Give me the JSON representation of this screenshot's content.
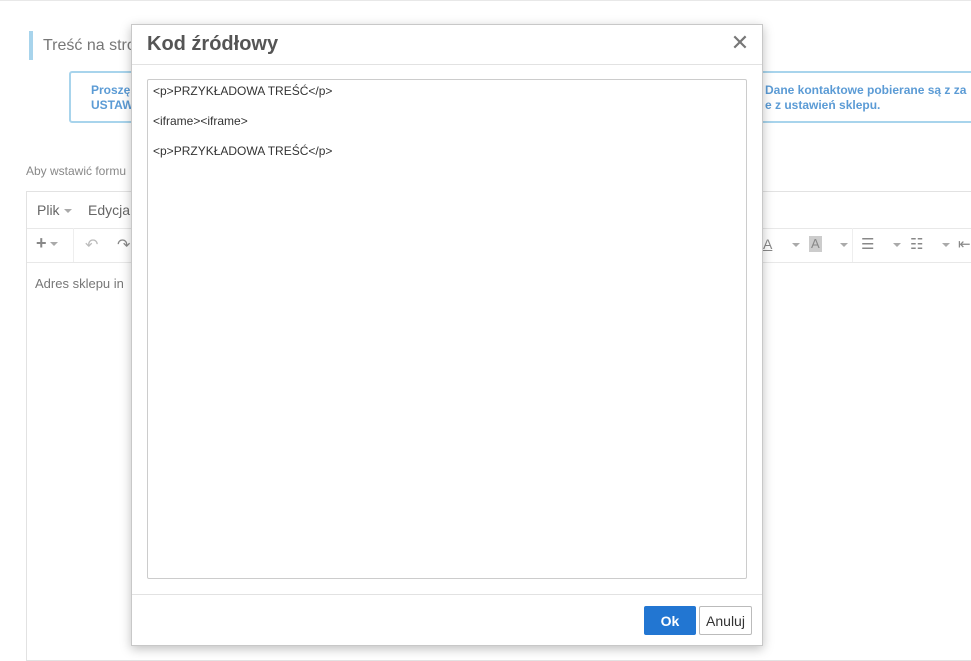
{
  "page": {
    "section_title": "Treść na stro",
    "info_left_line1": "Proszę",
    "info_left_line2": "USTAW",
    "info_right_line1": "Dane kontaktowe pobierane są z za",
    "info_right_line2": "e z ustawień sklepu.",
    "hint": "Aby wstawić formu"
  },
  "editor": {
    "menu": [
      {
        "label": "Plik"
      },
      {
        "label": "Edycja"
      }
    ],
    "content_text": "Adres sklepu in"
  },
  "modal": {
    "title": "Kod źródłowy",
    "close_symbol": "✕",
    "code_lines": [
      "<p>PRZYKŁADOWA TREŚĆ</p>",
      "<iframe><iframe>",
      "<p>PRZYKŁADOWA TREŚĆ</p>"
    ],
    "ok_label": "Ok",
    "cancel_label": "Anuluj"
  },
  "icons": {
    "add": "plus-icon",
    "undo": "undo-icon",
    "redo": "redo-icon",
    "font_color": "font-color-icon",
    "bg_color": "background-color-icon",
    "bullet_list": "bullet-list-icon",
    "numbered_list": "numbered-list-icon",
    "outdent": "outdent-icon"
  },
  "colors": {
    "accent": "#2276d2",
    "info_border": "#a8d4ec",
    "info_text": "#5b9bd5"
  }
}
